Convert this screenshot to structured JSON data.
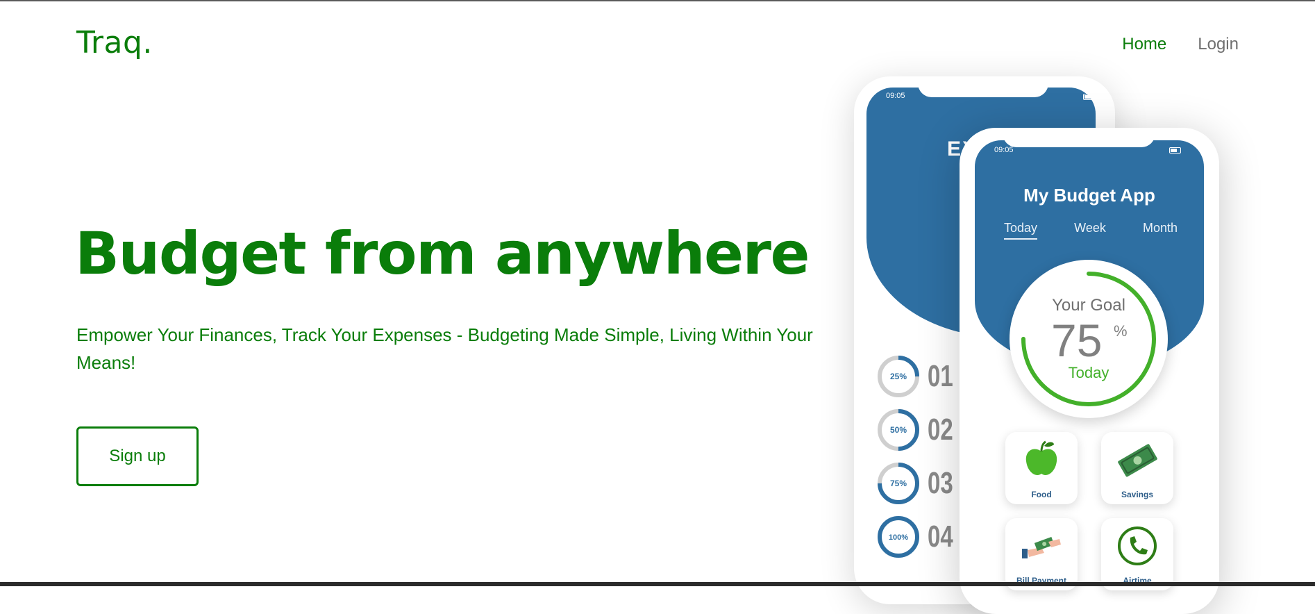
{
  "brand": {
    "logo": "Traq."
  },
  "nav": {
    "home": "Home",
    "login": "Login"
  },
  "hero": {
    "title": "Budget from anywhere",
    "subtitle": "Empower Your Finances, Track Your Expenses - Budgeting Made Simple, Living Within Your Means!",
    "signup_label": "Sign up"
  },
  "phone_back": {
    "time": "09:05",
    "title_fragment": "EX",
    "rings": [
      {
        "percent_label": "25%",
        "number": "01",
        "value": 0.25
      },
      {
        "percent_label": "50%",
        "number": "02",
        "value": 0.5
      },
      {
        "percent_label": "75%",
        "number": "03",
        "value": 0.75
      },
      {
        "percent_label": "100%",
        "number": "04",
        "value": 1.0
      }
    ]
  },
  "phone_front": {
    "time": "09:05",
    "app_title": "My Budget App",
    "tabs": [
      "Today",
      "Week",
      "Month"
    ],
    "active_tab": "Today",
    "goal": {
      "label": "Your Goal",
      "value": "75",
      "unit": "%",
      "period": "Today",
      "progress": 0.75
    },
    "tiles": [
      {
        "label": "Food",
        "icon": "apple-icon"
      },
      {
        "label": "Savings",
        "icon": "money-icon"
      },
      {
        "label": "Bill Payment",
        "icon": "payment-hand-icon"
      },
      {
        "label": "Airtime",
        "icon": "phone-icon"
      }
    ]
  },
  "colors": {
    "brand_green": "#0a7d0a",
    "app_blue": "#2e6fa2",
    "goal_green": "#43b02a",
    "nav_gray": "#6f6f6f"
  }
}
